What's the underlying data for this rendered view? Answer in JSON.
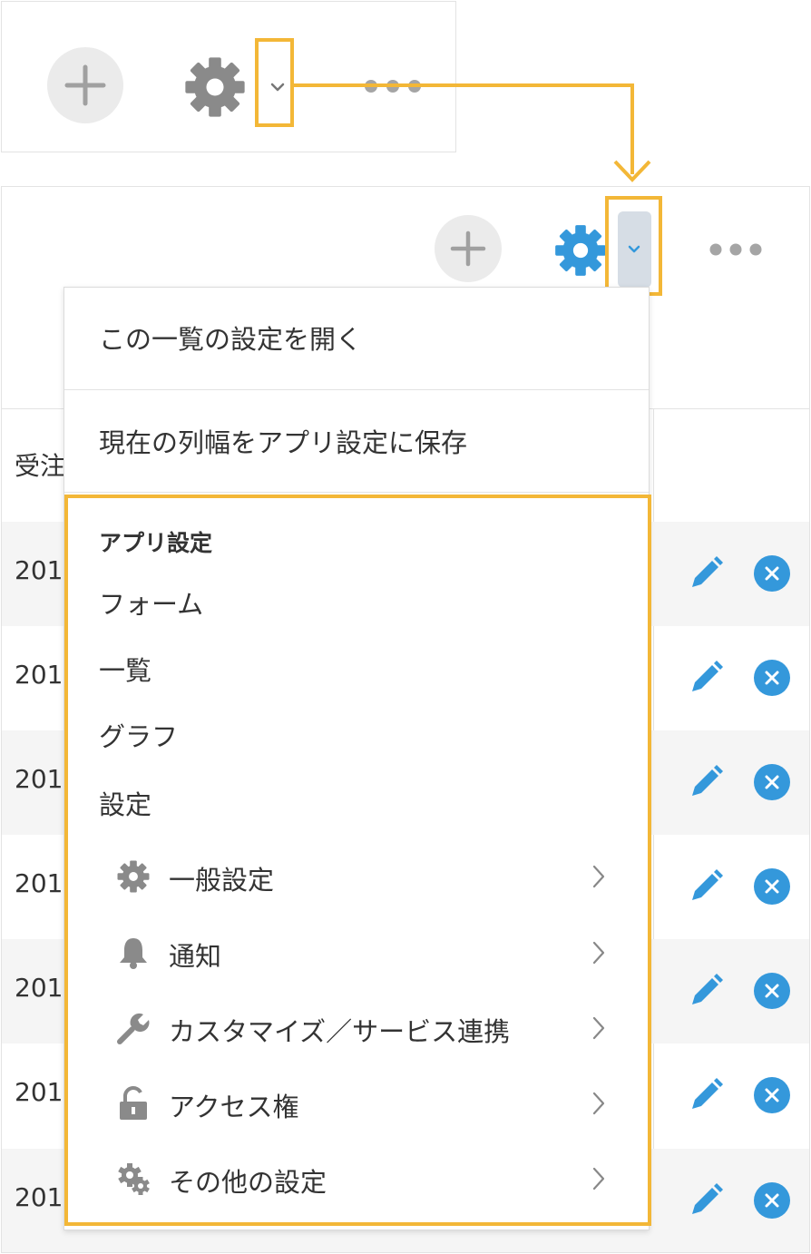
{
  "colors": {
    "highlight": "#f3b737",
    "accent": "#3498db",
    "gear_gray": "#8a8a8a",
    "plus_bg": "#ebebeb"
  },
  "mini_toolbar": {
    "icons": [
      "plus-icon",
      "gear-icon",
      "chevron-down-icon",
      "more-icon"
    ]
  },
  "main_toolbar": {
    "icons": [
      "plus-icon",
      "gear-icon",
      "chevron-down-icon",
      "more-icon"
    ]
  },
  "table": {
    "header_partial": "受注",
    "rows": [
      "201",
      "201",
      "201",
      "201",
      "201",
      "201",
      "201"
    ]
  },
  "dropdown": {
    "open_list_settings": "この一覧の設定を開く",
    "save_column_width": "現在の列幅をアプリ設定に保存",
    "app_settings_heading": "アプリ設定",
    "form": "フォーム",
    "list": "一覧",
    "graph": "グラフ",
    "settings": "設定",
    "sub_items": [
      {
        "icon": "gear-icon",
        "label": "一般設定"
      },
      {
        "icon": "bell-icon",
        "label": "通知"
      },
      {
        "icon": "wrench-icon",
        "label": "カスタマイズ／サービス連携"
      },
      {
        "icon": "lock-icon",
        "label": "アクセス権"
      },
      {
        "icon": "gears-icon",
        "label": "その他の設定"
      }
    ]
  }
}
